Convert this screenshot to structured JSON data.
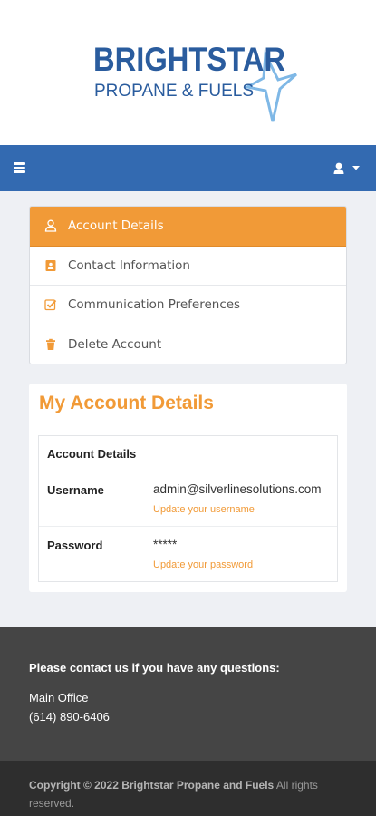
{
  "brand": {
    "name_line1": "BRIGHTSTAR",
    "name_line2": "PROPANE & FUELS",
    "primary_color": "#2a5c9e",
    "accent_color": "#f19a37"
  },
  "navbar": {
    "menu_icon": "hamburger-icon",
    "user_icon": "user-icon"
  },
  "side_menu": {
    "items": [
      {
        "label": "Account Details",
        "icon": "user-icon",
        "active": true
      },
      {
        "label": "Contact Information",
        "icon": "contact-card-icon",
        "active": false
      },
      {
        "label": "Communication Preferences",
        "icon": "checkbox-icon",
        "active": false
      },
      {
        "label": "Delete Account",
        "icon": "trash-icon",
        "active": false
      }
    ]
  },
  "account": {
    "title": "My Account Details",
    "panel_heading": "Account Details",
    "rows": [
      {
        "label": "Username",
        "value": "admin@silverlinesolutions.com",
        "link": "Update your username"
      },
      {
        "label": "Password",
        "value": "*****",
        "link": "Update your password"
      }
    ]
  },
  "footer": {
    "heading": "Please contact us if you have any questions:",
    "office": "Main Office",
    "phone": "(614) 890-6406"
  },
  "copyright": {
    "bold": "Copyright © 2022 Brightstar Propane and Fuels",
    "rest": " All rights reserved."
  }
}
